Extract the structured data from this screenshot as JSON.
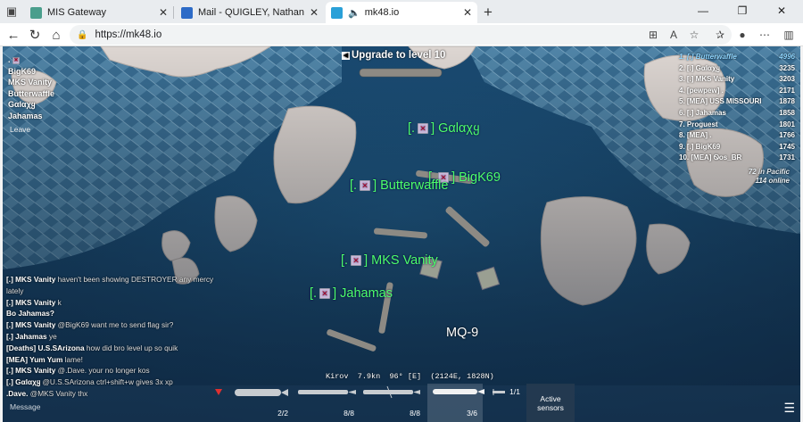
{
  "browser": {
    "tabs": [
      {
        "title": "MIS Gateway",
        "active": false
      },
      {
        "title": "Mail - QUIGLEY, Nathan (nquig3)",
        "active": false
      },
      {
        "title": "mk48.io",
        "active": true
      }
    ],
    "url": "https://mk48.io"
  },
  "game": {
    "upgrade_text": "Upgrade to level 10",
    "team": {
      "tag": ".",
      "members": [
        "BigK69",
        "MKS Vanity",
        "Butterwaffle",
        "Gαlαχყ",
        "Jahamas"
      ],
      "leave_label": "Leave"
    },
    "leaderboard": [
      {
        "rank": "1.",
        "name": "[.] Butterwaffle",
        "score": "4996",
        "me": true
      },
      {
        "rank": "2.",
        "name": "[.] Gαlαχყ",
        "score": "3235",
        "me": false
      },
      {
        "rank": "3.",
        "name": "[.] MKS Vanity",
        "score": "3203",
        "me": false
      },
      {
        "rank": "4.",
        "name": "[pewpew] .",
        "score": "2171",
        "me": false
      },
      {
        "rank": "5.",
        "name": "[MEA] USS MISSOURI",
        "score": "1878",
        "me": false
      },
      {
        "rank": "6.",
        "name": "[.] Jahamas",
        "score": "1858",
        "me": false
      },
      {
        "rank": "7.",
        "name": "Proguest",
        "score": "1801",
        "me": false
      },
      {
        "rank": "8.",
        "name": "[MEA] .",
        "score": "1766",
        "me": false
      },
      {
        "rank": "9.",
        "name": "[.] BigK69",
        "score": "1745",
        "me": false
      },
      {
        "rank": "10.",
        "name": "[MEA] Ꮻos_BR",
        "score": "1731",
        "me": false
      }
    ],
    "server_info": [
      "72 in Pacific",
      "114 online"
    ],
    "ship_labels": {
      "galaxy": "Gαlαχყ",
      "bigk": "BigK69",
      "butterwaffle": "Butterwaffle",
      "vanity": "MKS Vanity",
      "jahamas": "Jahamas"
    },
    "mq9_label": "MQ-9",
    "chat": [
      {
        "who": "[.] MKS Vanity",
        "msg": "haven't been showing DESTROYER any mercy lately"
      },
      {
        "who": "[.] MKS Vanity",
        "msg": "k"
      },
      {
        "who": "Bo Jahamas?",
        "msg": ""
      },
      {
        "who": "[.] MKS Vanity",
        "msg": "@BigK69 want me to send flag sir?"
      },
      {
        "who": "[.] Jahamas",
        "msg": "ye"
      },
      {
        "who": "[Deaths] U.S.SArizona",
        "msg": "how did bro level up so quik"
      },
      {
        "who": "[MEA] Yum Yum",
        "msg": "lame!"
      },
      {
        "who": "[.] MKS Vanity",
        "msg": "@.Dave. your no longer kos"
      },
      {
        "who": "[.] Gαlαχყ",
        "msg": "@U.S.SArizona ctrl+shift+w gives 3x xp"
      },
      {
        "who": ".Dave.",
        "msg": "@MKS Vanity thx"
      }
    ],
    "message_placeholder": "Message",
    "status": {
      "ship": "Kirov",
      "speed": "7.9kn",
      "heading": "96° [E]",
      "coords": "(2124E, 1828N)"
    },
    "weapons": [
      {
        "count": "2/2"
      },
      {
        "count": "8/8"
      },
      {
        "count": "8/8"
      },
      {
        "count": "3/6"
      },
      {
        "count": "1/1"
      }
    ],
    "sensors_label": "Active sensors"
  }
}
